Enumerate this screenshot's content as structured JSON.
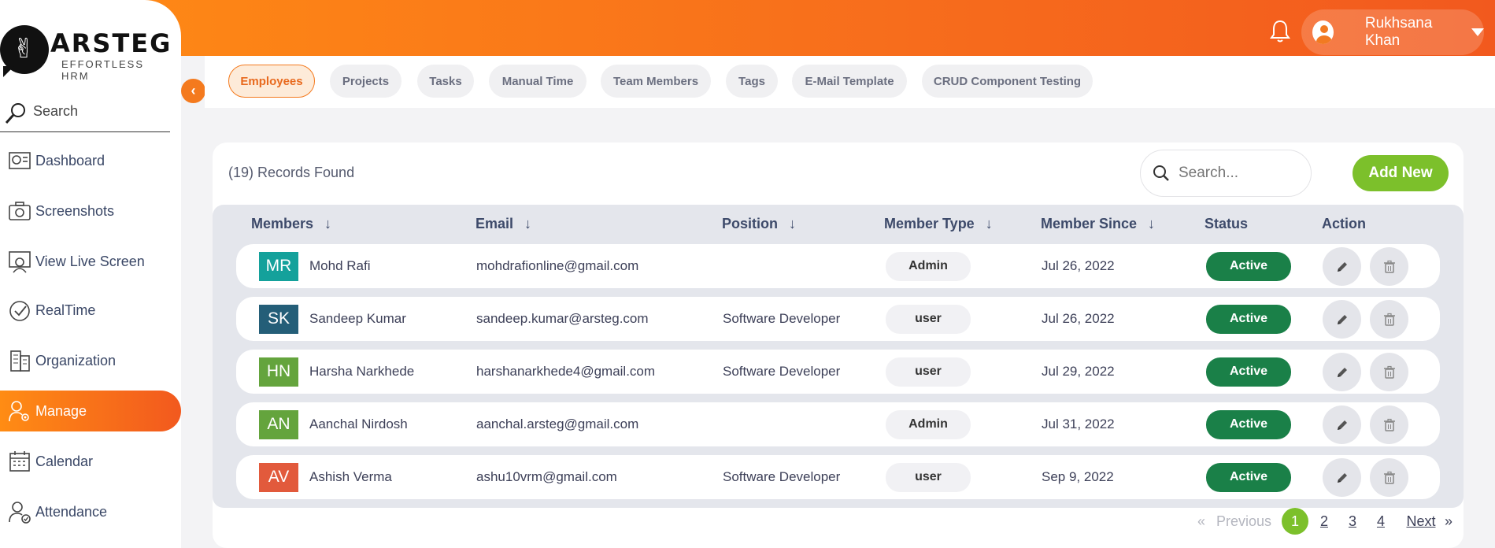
{
  "brand": {
    "name": "ARSTEG",
    "tagline": "EFFORTLESS HRM"
  },
  "header": {
    "user_name": "Rukhsana Khan",
    "notification_icon": "bell-icon",
    "accent": "#f47a1e"
  },
  "sidebar": {
    "search_label": "Search",
    "items": [
      {
        "label": "Dashboard",
        "icon": "dashboard-icon"
      },
      {
        "label": "Screenshots",
        "icon": "camera-icon"
      },
      {
        "label": "View Live Screen",
        "icon": "live-screen-icon"
      },
      {
        "label": "RealTime",
        "icon": "realtime-icon"
      },
      {
        "label": "Organization",
        "icon": "organization-icon"
      },
      {
        "label": "Manage",
        "icon": "manage-icon",
        "active": true
      },
      {
        "label": "Calendar",
        "icon": "calendar-icon"
      },
      {
        "label": "Attendance",
        "icon": "attendance-icon"
      }
    ]
  },
  "tabs": [
    {
      "label": "Employees",
      "active": true
    },
    {
      "label": "Projects"
    },
    {
      "label": "Tasks"
    },
    {
      "label": "Manual Time"
    },
    {
      "label": "Team Members"
    },
    {
      "label": "Tags"
    },
    {
      "label": "E-Mail Template"
    },
    {
      "label": "CRUD Component Testing"
    }
  ],
  "main": {
    "records_text": "(19) Records Found",
    "search_placeholder": "Search...",
    "add_new_label": "Add New",
    "columns": [
      "Members",
      "Email",
      "Position",
      "Member Type",
      "Member Since",
      "Status",
      "Action"
    ],
    "rows": [
      {
        "initials": "MR",
        "color": "#14a19b",
        "name": "Mohd Rafi",
        "email": "mohdrafionline@gmail.com",
        "position": "",
        "type": "Admin",
        "since": "Jul 26, 2022",
        "status": "Active"
      },
      {
        "initials": "SK",
        "color": "#245e78",
        "name": "Sandeep Kumar",
        "email": "sandeep.kumar@arsteg.com",
        "position": "Software Developer",
        "type": "user",
        "since": "Jul 26, 2022",
        "status": "Active"
      },
      {
        "initials": "HN",
        "color": "#64a43d",
        "name": "Harsha Narkhede",
        "email": "harshanarkhede4@gmail.com",
        "position": "Software Developer",
        "type": "user",
        "since": "Jul 29, 2022",
        "status": "Active"
      },
      {
        "initials": "AN",
        "color": "#64a43d",
        "name": "Aanchal Nirdosh",
        "email": "aanchal.arsteg@gmail.com",
        "position": "",
        "type": "Admin",
        "since": "Jul 31, 2022",
        "status": "Active"
      },
      {
        "initials": "AV",
        "color": "#e25a3c",
        "name": "Ashish Verma",
        "email": "ashu10vrm@gmail.com",
        "position": "Software Developer",
        "type": "user",
        "since": "Sep 9, 2022",
        "status": "Active"
      }
    ]
  },
  "pagination": {
    "first": "«",
    "previous": "Previous",
    "pages": [
      "1",
      "2",
      "3",
      "4"
    ],
    "current_page": "1",
    "next": "Next",
    "last": "»"
  }
}
